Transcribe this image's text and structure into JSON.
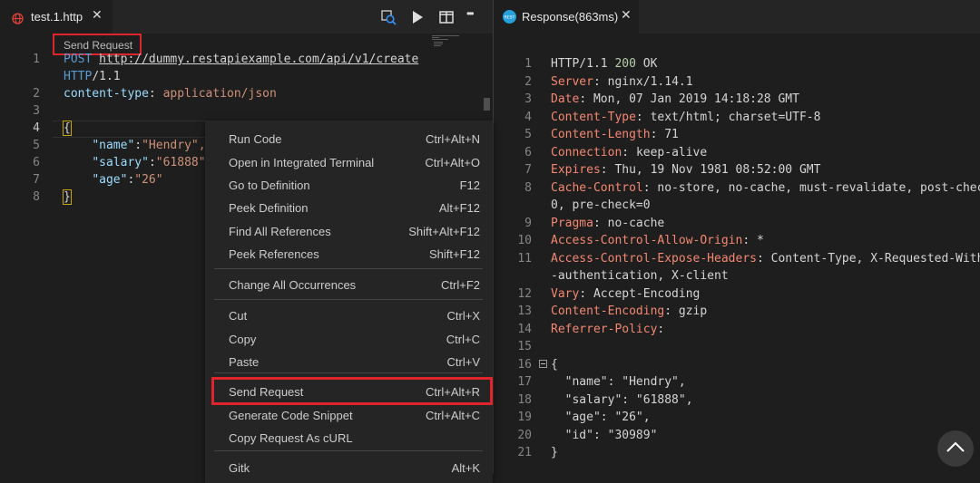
{
  "left": {
    "tab_title": "test.1.http",
    "tab_close": "✕",
    "codelens": "Send Request",
    "line_numbers": [
      "1",
      "2",
      "3",
      "4",
      "5",
      "6",
      "7",
      "8"
    ],
    "code": {
      "method": "POST",
      "url": "http://dummy.restapiexample.com/api/v1/create",
      "http_version_kw": "HTTP",
      "http_version_rest": "/1.1",
      "header_name": "content-type",
      "header_value": "application/json",
      "open_brace": "{",
      "name_key": "\"name\"",
      "name_val": "\"Hendry\",",
      "salary_key": "\"salary\"",
      "salary_val": "\"61888\"",
      "age_key": "\"age\"",
      "age_val": "\"26\"",
      "close_brace": "}"
    }
  },
  "toolbar_icons": [
    "open-changes-icon",
    "run-icon",
    "split-editor-icon",
    "more-actions-icon"
  ],
  "toolbar_more": "•••",
  "context_menu": {
    "items": [
      {
        "label": "Run Code",
        "shortcut": "Ctrl+Alt+N"
      },
      {
        "label": "Open in Integrated Terminal",
        "shortcut": "Ctrl+Alt+O"
      },
      {
        "label": "Go to Definition",
        "shortcut": "F12"
      },
      {
        "label": "Peek Definition",
        "shortcut": "Alt+F12"
      },
      {
        "label": "Find All References",
        "shortcut": "Shift+Alt+F12"
      },
      {
        "label": "Peek References",
        "shortcut": "Shift+F12"
      },
      {
        "label": "Change All Occurrences",
        "shortcut": "Ctrl+F2"
      },
      {
        "label": "Cut",
        "shortcut": "Ctrl+X"
      },
      {
        "label": "Copy",
        "shortcut": "Ctrl+C"
      },
      {
        "label": "Paste",
        "shortcut": "Ctrl+V"
      },
      {
        "label": "Send Request",
        "shortcut": "Ctrl+Alt+R"
      },
      {
        "label": "Generate Code Snippet",
        "shortcut": "Ctrl+Alt+C"
      },
      {
        "label": "Copy Request As cURL",
        "shortcut": ""
      },
      {
        "label": "Gitk",
        "shortcut": "Alt+K"
      }
    ]
  },
  "right": {
    "tab_icon_text": "REST",
    "tab_title": "Response(863ms)",
    "tab_close": "✕",
    "line_numbers": [
      "1",
      "2",
      "3",
      "4",
      "5",
      "6",
      "7",
      "8",
      "",
      "9",
      "10",
      "11",
      "",
      "12",
      "13",
      "14",
      "15",
      "16",
      "17",
      "18",
      "19",
      "20",
      "21"
    ],
    "status": {
      "version": "HTTP/1.1",
      "code": "200",
      "text": "OK"
    },
    "headers": [
      {
        "name": "Server",
        "value": "nginx/1.14.1"
      },
      {
        "name": "Date",
        "value": "Mon, 07 Jan 2019 14:18:28 GMT"
      },
      {
        "name": "Content-Type",
        "value": "text/html; charset=UTF-8"
      },
      {
        "name": "Content-Length",
        "value": "71"
      },
      {
        "name": "Connection",
        "value": "keep-alive"
      },
      {
        "name": "Expires",
        "value": "Thu, 19 Nov 1981 08:52:00 GMT"
      },
      {
        "name": "Cache-Control",
        "value": "no-store, no-cache, must-revalidate, post-check=",
        "cont": "0, pre-check=0"
      },
      {
        "name": "Pragma",
        "value": "no-cache"
      },
      {
        "name": "Access-Control-Allow-Origin",
        "value": "*"
      },
      {
        "name": "Access-Control-Expose-Headers",
        "value": "Content-Type, X-Requested-With, X",
        "cont": "-authentication, X-client"
      },
      {
        "name": "Vary",
        "value": "Accept-Encoding"
      },
      {
        "name": "Content-Encoding",
        "value": "gzip"
      },
      {
        "name": "Referrer-Policy",
        "value": ""
      }
    ],
    "body_lines": [
      "{",
      "  \"name\": \"Hendry\",",
      "  \"salary\": \"61888\",",
      "  \"age\": \"26\",",
      "  \"id\": \"30989\"",
      "}"
    ]
  },
  "colors": {
    "highlight_red": "#e0242b",
    "header_name": "#f48771",
    "keyword": "#569cd6",
    "string": "#ce9178"
  }
}
